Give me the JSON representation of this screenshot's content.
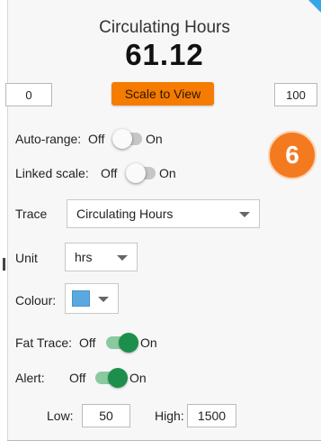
{
  "header": {
    "title": "Circulating Hours",
    "value": "61.12"
  },
  "range": {
    "min": "0",
    "max": "100",
    "scale_button": "Scale to View"
  },
  "auto_range": {
    "label": "Auto-range:",
    "off": "Off",
    "on": "On",
    "state": "off"
  },
  "linked_scale": {
    "label": "Linked scale:",
    "off": "Off",
    "on": "On",
    "state": "off"
  },
  "badge": {
    "text": "6",
    "color": "#f47a20"
  },
  "trace": {
    "label": "Trace",
    "selected": "Circulating Hours"
  },
  "unit": {
    "label": "Unit",
    "selected": "hrs"
  },
  "colour": {
    "label": "Colour:",
    "value": "#5aa8e0"
  },
  "fat_trace": {
    "label": "Fat Trace:",
    "off": "Off",
    "on": "On",
    "state": "on"
  },
  "alert": {
    "label": "Alert:",
    "off": "Off",
    "on": "On",
    "state": "on",
    "low_label": "Low:",
    "low_value": "50",
    "high_label": "High:",
    "high_value": "1500"
  },
  "colors": {
    "accent": "#f57c00",
    "toggle_on": "#1b8f4b",
    "corner": "#35a7e8"
  }
}
